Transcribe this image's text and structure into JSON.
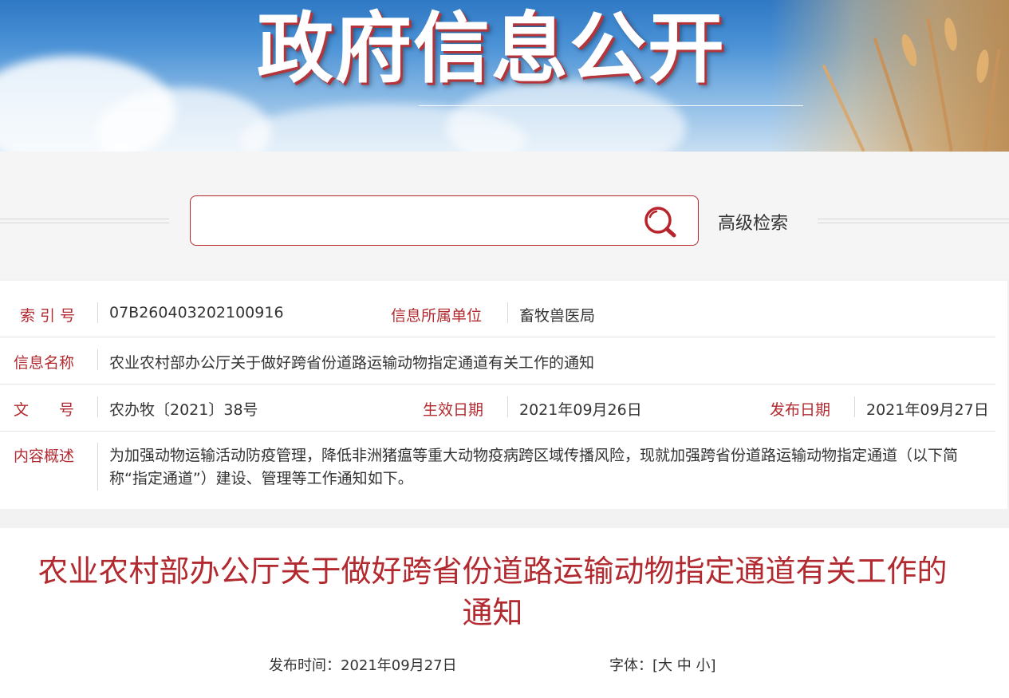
{
  "banner": {
    "title": "政府信息公开"
  },
  "search": {
    "value": "",
    "placeholder": "",
    "advanced_label": "高级检索"
  },
  "info": {
    "index_label": "索 引 号",
    "index_value": "07B260403202100916",
    "unit_label": "信息所属单位",
    "unit_value": "畜牧兽医局",
    "name_label": "信息名称",
    "name_value": "农业农村部办公厅关于做好跨省份道路运输动物指定通道有关工作的通知",
    "doc_no_label": "文　　号",
    "doc_no_value": "农办牧〔2021〕38号",
    "effective_label": "生效日期",
    "effective_value": "2021年09月26日",
    "publish_label": "发布日期",
    "publish_value": "2021年09月27日",
    "summary_label": "内容概述",
    "summary_value": "为加强动物运输活动防疫管理，降低非洲猪瘟等重大动物疫病跨区域传播风险，现就加强跨省份道路运输动物指定通道（以下简称“指定通道”）建设、管理等工作通知如下。"
  },
  "article": {
    "title": "农业农村部办公厅关于做好跨省份道路运输动物指定通道有关工作的通知",
    "publish_time_label": "发布时间：",
    "publish_time_value": "2021年09月27日",
    "font_label": "字体：",
    "font_open": "[",
    "font_large": "大",
    "font_medium": "中",
    "font_small": "小",
    "font_close": "]"
  },
  "colors": {
    "accent_red": "#b22a2f",
    "search_border": "#b8242b"
  },
  "icons": {
    "search": "search-icon"
  }
}
